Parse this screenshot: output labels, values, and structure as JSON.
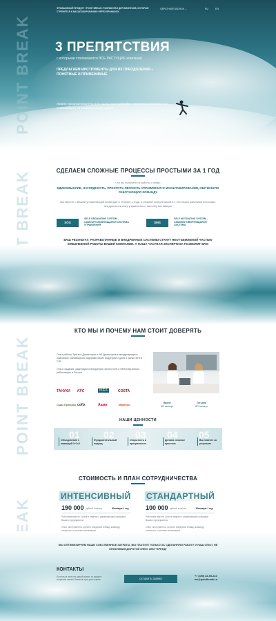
{
  "hero": {
    "top_text": "ФРАНШИЗНЫЙ ПРОДУКТ «POINT BREAK» РАЗРАБОТАН ДЛЯ БИЗНЕСОВ, КОТОРЫЕ СТРЕМЯТСЯ К МАСШТАБИРОВАНИЮ ЧЕРЕЗ ФРАНШИЗУ",
    "nav_phone": "ОБРАТНЫЙ ЗВОНОК",
    "nav_lang_ru": "RU",
    "nav_lang_en": "EN",
    "title": "3 ПРЕПЯТСТВИЯ",
    "subtitle": "с которыми сталкиваются ВСЕ РАСТУЩИЕ компании",
    "offer": "ПРЕДЛАГАЕМ ИНСТРУМЕНТЫ ДЛЯ ИХ ПРЕОДОЛЕНИЯ – ПОНЯТНЫЕ И ПРИМЕНИМЫЕ",
    "tagline": "Ловите предпринимательскую волну, выстраивайте стратегию развития и не отвлекайтесь на операционные задачи"
  },
  "brand": {
    "vertical": "POINT BREAK"
  },
  "section1": {
    "title": "СДЕЛАЕМ СЛОЖНЫЕ ПРОЦЕССЫ ПРОСТЫМИ ЗА 1 ГОД",
    "lead": "Что вы получите от работы с нами:",
    "benefits": "ЕДИНОМЫСЛИЕ, НАГЛЯДНОСТЬ, ПРОСТОТУ, ЛЕГКОСТЬ УПРАВЛЕНИЯ И МАСШТАБИРОВАНИЯ, ОБУЧЕННУЮ РАБОТАЮЩУЮ КОМАНДУ",
    "desc": "Мы вместе с Вашей управляющей командой в течение 1 года, в режиме консультаций и с честными рабочими сессиями, внедряем систему управления и систему мотивации",
    "badge1": "SOS",
    "badge1_text": "SELF ORGANIZING SYSTEM – САМООРГАНИЗУЮЩАЯСЯ СИСТЕМА УПРАВЛЕНИЯ",
    "badge2": "SMS",
    "badge2_text": "SELF MOTIVATING SYSTEM – САМОМОТИВИРУЮЩАЯСЯ СИСТЕМА",
    "result": "ВАШ РЕЗУЛЬТАТ: РАЗРАБОТАННЫЕ И ВНЕДРЕННЫЕ СИСТЕМЫ СТАНУТ НЕОТЪЕМЛЕМОЙ ЧАСТЬЮ ЕЖЕДНЕВНОЙ РАБОТЫ ВАШЕЙ КОМПАНИИ, А НАША ЧАСТНАЯ ЭКСПЕРТИЗА ПОЗВОЛИТ ВАМ СФОКУСИРОВАТЬСЯ"
  },
  "section2": {
    "title": "КТО МЫ И ПОЧЕМУ НАМ СТОИТ ДОВЕРЯТЬ",
    "about1": "Опыт работы Третьих Директоров и HR Директоров в международных компаниях, являющихся лидерами своих индустрий с доля в рынке 40% в CIS",
    "about2": "Опыт создания, адаптации и внедрения систем SOS и SMS в Бизнесах, работающих в России",
    "logos": [
      "ТАНУКИ",
      "KFC",
      "IKEA",
      "COSTA",
      "Сады Пригорья",
      "cofix",
      "Ашан",
      "Мираторг"
    ],
    "person1": "Ирина",
    "person1_role": "HR эксперт",
    "person2": "Татьяна",
    "person2_role": "HR эксперт",
    "values_title": "НАШИ ЦЕННОСТИ",
    "values": [
      "Объединение с командой 1+1=3",
      "Фундаментальный подход",
      "Открытость и прозрачность",
      "Делаем сложное простым",
      "Вы платите за результат"
    ],
    "value_nums": [
      "01",
      "02",
      "03",
      "04",
      "05"
    ]
  },
  "section3": {
    "title": "СТОИМОСТЬ И ПЛАН СОТРУДНИЧЕСТВА",
    "plan1_name": "ИНТЕНСИВНЫЙ",
    "plan1_price": "190 000",
    "plan1_unit": "рублей в месяц",
    "plan1_term": "Минимум 1 год",
    "plan1_desc1": "Работаем вместе 3 раза в неделю с управляющей командой Вашего предприятия",
    "plan1_desc2": "Опыт, инструменты, коучинг внедряем в Вашу команду, процессы и систему управления",
    "plan2_name": "СТАНДАРТНЫЙ",
    "plan2_price": "100 000",
    "plan2_unit": "рублей в месяц",
    "plan2_term": "Минимум 1 год",
    "plan2_desc1": "Работаем вместе 1 раз в неделю с управляющей командой Вашего предприятия",
    "plan2_desc2": "Опыт, инструменты, коучинг внедряем в Вашу команду, процессы и систему управления",
    "note": "МЫ ОПТИМИЗИРУЕМ НАШИ СОБСТВЕННЫЕ ЗАТРАТЫ, ВЫ ПЛАТИТЕ ТОЛЬКО ЗА СДЕЛАННУЮ РАБОТУ И НАШ ОПЫТ, НЕ ОПЛАЧИВАЯ ДОРОГОЙ ОФИС ИЛИ \"БРЕНД\""
  },
  "contacts": {
    "title": "КОНТАКТЫ",
    "text": "Если вы в этом на одной волне, то пишите встретим самые бизнеса пути для старта",
    "button": "ОСТАВИТЬ ЗАЯВКУ",
    "phone": "+7 (495) 32-95-222",
    "email": "we@pointbreak.ru"
  },
  "colors": {
    "accent": "#1e6c7a",
    "text": "#1f2d32"
  }
}
